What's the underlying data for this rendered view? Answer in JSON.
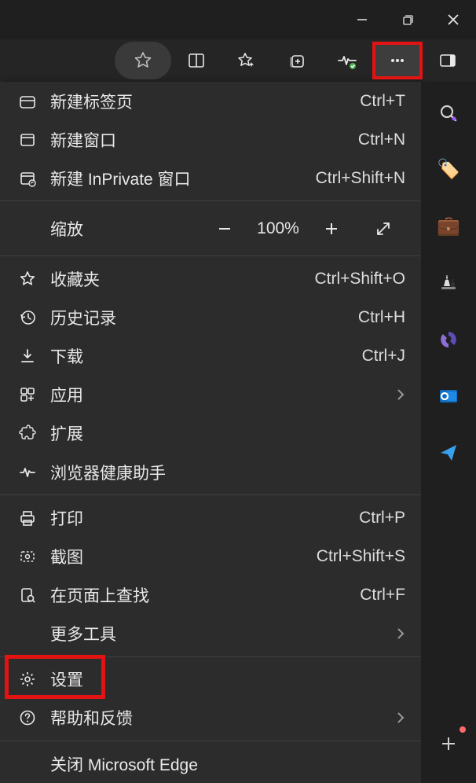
{
  "titlebar": {
    "minimize": "minimize",
    "maximize": "maximize",
    "close": "close"
  },
  "toolbar": {
    "star": "star",
    "split": "split-screen",
    "sparkle": "favorites-sparkle",
    "collections": "collections",
    "heartbeat": "health",
    "more": "more",
    "panel": "panel-toggle"
  },
  "menu": {
    "newTab": {
      "label": "新建标签页",
      "shortcut": "Ctrl+T"
    },
    "newWindow": {
      "label": "新建窗口",
      "shortcut": "Ctrl+N"
    },
    "newInPrivate": {
      "label": "新建 InPrivate 窗口",
      "shortcut": "Ctrl+Shift+N"
    },
    "zoom": {
      "label": "缩放",
      "value": "100%"
    },
    "favorites": {
      "label": "收藏夹",
      "shortcut": "Ctrl+Shift+O"
    },
    "history": {
      "label": "历史记录",
      "shortcut": "Ctrl+H"
    },
    "downloads": {
      "label": "下载",
      "shortcut": "Ctrl+J"
    },
    "apps": {
      "label": "应用"
    },
    "extensions": {
      "label": "扩展"
    },
    "browserHealth": {
      "label": "浏览器健康助手"
    },
    "print": {
      "label": "打印",
      "shortcut": "Ctrl+P"
    },
    "screenshot": {
      "label": "截图",
      "shortcut": "Ctrl+Shift+S"
    },
    "findOnPage": {
      "label": "在页面上查找",
      "shortcut": "Ctrl+F"
    },
    "moreTools": {
      "label": "更多工具"
    },
    "settings": {
      "label": "设置"
    },
    "helpFeedback": {
      "label": "帮助和反馈"
    },
    "closeApp": {
      "label": "关闭 Microsoft Edge"
    }
  },
  "sidebar": {
    "search": "search",
    "tag": "tag",
    "briefcase": "briefcase",
    "chess": "chess",
    "office": "microsoft-365",
    "outlook": "outlook",
    "send": "send",
    "add": "add"
  }
}
